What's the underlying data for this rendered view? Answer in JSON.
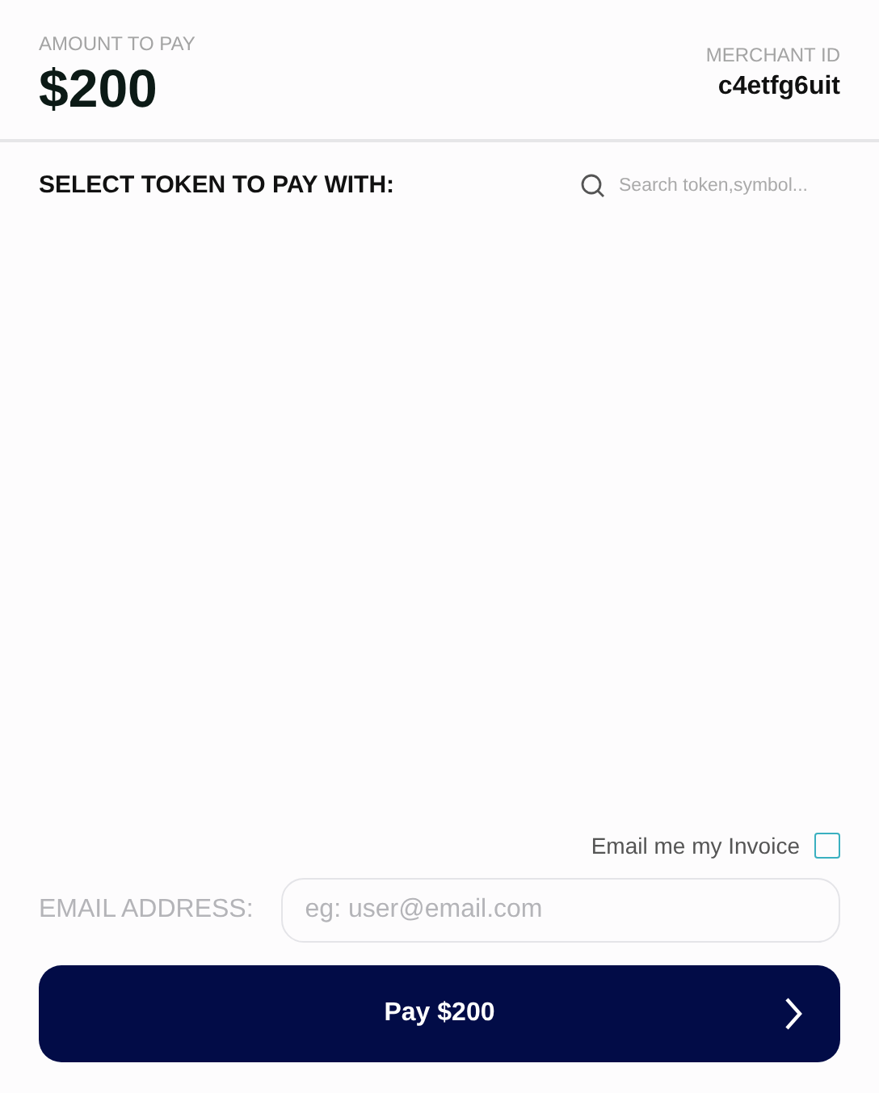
{
  "header": {
    "amount_label": "AMOUNT TO PAY",
    "amount": "$200",
    "merchant_label": "MERCHANT ID",
    "merchant_id": "c4etfg6uit"
  },
  "token_section": {
    "title": "SELECT TOKEN TO PAY WITH:",
    "search": {
      "placeholder": "Search token,symbol..."
    }
  },
  "invoice_option": {
    "label": "Email me my Invoice",
    "checked": false
  },
  "email": {
    "label": "EMAIL ADDRESS:",
    "placeholder": "eg: user@email.com",
    "disabled": true
  },
  "pay_button": {
    "label": "Pay $200"
  }
}
